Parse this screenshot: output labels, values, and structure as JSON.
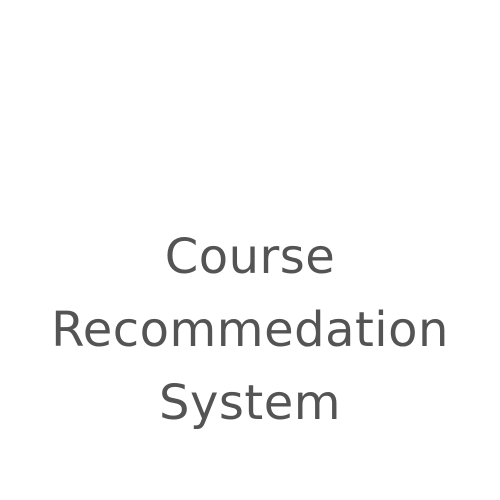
{
  "title": {
    "lines": [
      "Course",
      "Recommedation",
      "System"
    ],
    "color": "#545454"
  },
  "background_color": "#ffffff"
}
